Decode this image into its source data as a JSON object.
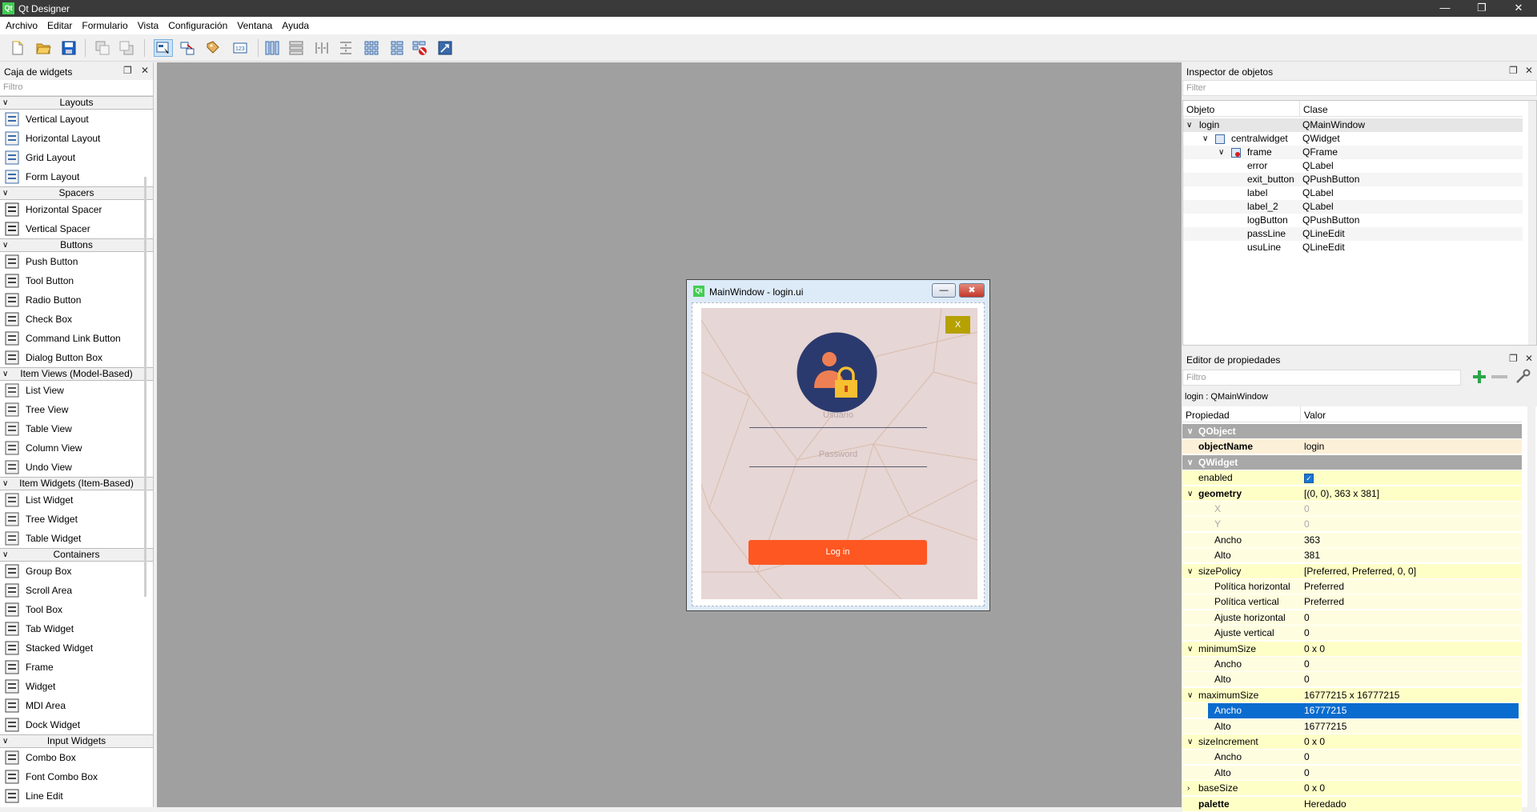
{
  "app": {
    "title": "Qt Designer",
    "logo": "Qt"
  },
  "window_buttons": {
    "minimize": "—",
    "maximize": "❐",
    "close": "✕"
  },
  "menu": [
    "Archivo",
    "Editar",
    "Formulario",
    "Vista",
    "Configuración",
    "Ventana",
    "Ayuda"
  ],
  "toolbar": [
    "new-icon",
    "open-icon",
    "save-icon",
    "send-to-back-icon",
    "bring-to-front-icon",
    "edit-widgets-icon",
    "edit-signals-icon",
    "edit-buddies-icon",
    "edit-tab-order-icon",
    "layout-horizontal-icon",
    "layout-vertical-icon",
    "layout-h-splitter-icon",
    "layout-v-splitter-icon",
    "layout-grid-icon",
    "layout-form-icon",
    "break-layout-icon",
    "adjust-size-icon"
  ],
  "widget_box": {
    "title": "Caja de widgets",
    "filter": "Filtro",
    "categories": [
      {
        "name": "Layouts",
        "items": [
          "Vertical Layout",
          "Horizontal Layout",
          "Grid Layout",
          "Form Layout"
        ]
      },
      {
        "name": "Spacers",
        "items": [
          "Horizontal Spacer",
          "Vertical Spacer"
        ]
      },
      {
        "name": "Buttons",
        "items": [
          "Push Button",
          "Tool Button",
          "Radio Button",
          "Check Box",
          "Command Link Button",
          "Dialog Button Box"
        ]
      },
      {
        "name": "Item Views (Model-Based)",
        "items": [
          "List View",
          "Tree View",
          "Table View",
          "Column View",
          "Undo View"
        ]
      },
      {
        "name": "Item Widgets (Item-Based)",
        "items": [
          "List Widget",
          "Tree Widget",
          "Table Widget"
        ]
      },
      {
        "name": "Containers",
        "items": [
          "Group Box",
          "Scroll Area",
          "Tool Box",
          "Tab Widget",
          "Stacked Widget",
          "Frame",
          "Widget",
          "MDI Area",
          "Dock Widget"
        ]
      },
      {
        "name": "Input Widgets",
        "items": [
          "Combo Box",
          "Font Combo Box",
          "Line Edit"
        ]
      }
    ]
  },
  "form_window": {
    "title": "MainWindow - login.ui",
    "min": "—",
    "close": "✖",
    "exit_button": "X",
    "usuario_placeholder": "Usuario",
    "password_placeholder": "Password",
    "login_button": "Log in",
    "colors": {
      "frame_bg": "#e6d6d5",
      "login": "#fe5722",
      "exit": "#b5a100",
      "avatar": "#2b3a6e"
    }
  },
  "object_inspector": {
    "title": "Inspector de objetos",
    "filter": "Filter",
    "columns": [
      "Objeto",
      "Clase"
    ],
    "rows": [
      {
        "object": "login",
        "class": "QMainWindow",
        "level": 0,
        "expand": "∨"
      },
      {
        "object": "centralwidget",
        "class": "QWidget",
        "level": 1,
        "expand": "∨"
      },
      {
        "object": "frame",
        "class": "QFrame",
        "level": 2,
        "expand": "∨"
      },
      {
        "object": "error",
        "class": "QLabel",
        "level": 3,
        "expand": ""
      },
      {
        "object": "exit_button",
        "class": "QPushButton",
        "level": 3,
        "expand": ""
      },
      {
        "object": "label",
        "class": "QLabel",
        "level": 3,
        "expand": ""
      },
      {
        "object": "label_2",
        "class": "QLabel",
        "level": 3,
        "expand": ""
      },
      {
        "object": "logButton",
        "class": "QPushButton",
        "level": 3,
        "expand": ""
      },
      {
        "object": "passLine",
        "class": "QLineEdit",
        "level": 3,
        "expand": ""
      },
      {
        "object": "usuLine",
        "class": "QLineEdit",
        "level": 3,
        "expand": ""
      }
    ]
  },
  "property_editor": {
    "title": "Editor de propiedades",
    "filter": "Filtro",
    "context": "login : QMainWindow",
    "columns": [
      "Propiedad",
      "Valor"
    ],
    "rows": [
      {
        "name": "QObject",
        "value": "",
        "type": "grp",
        "level": 0,
        "expand": "∨"
      },
      {
        "name": "objectName",
        "value": "login",
        "type": "r",
        "level": 1,
        "bold": true,
        "expand": ""
      },
      {
        "name": "QWidget",
        "value": "",
        "type": "grp",
        "level": 0,
        "expand": "∨"
      },
      {
        "name": "enabled",
        "value": "✓",
        "type": "y",
        "level": 1,
        "check": true,
        "expand": ""
      },
      {
        "name": "geometry",
        "value": "[(0, 0), 363 x 381]",
        "type": "y",
        "level": 1,
        "bold": true,
        "expand": "∨"
      },
      {
        "name": "X",
        "value": "0",
        "type": "yp",
        "level": 2,
        "dim": true,
        "expand": ""
      },
      {
        "name": "Y",
        "value": "0",
        "type": "yp",
        "level": 2,
        "dim": true,
        "expand": ""
      },
      {
        "name": "Ancho",
        "value": "363",
        "type": "yp",
        "level": 2,
        "expand": ""
      },
      {
        "name": "Alto",
        "value": "381",
        "type": "yp",
        "level": 2,
        "expand": ""
      },
      {
        "name": "sizePolicy",
        "value": "[Preferred, Preferred, 0, 0]",
        "type": "y",
        "level": 1,
        "expand": "∨"
      },
      {
        "name": "Política horizontal",
        "value": "Preferred",
        "type": "yp",
        "level": 2,
        "expand": ""
      },
      {
        "name": "Política vertical",
        "value": "Preferred",
        "type": "yp",
        "level": 2,
        "expand": ""
      },
      {
        "name": "Ajuste horizontal",
        "value": "0",
        "type": "yp",
        "level": 2,
        "expand": ""
      },
      {
        "name": "Ajuste vertical",
        "value": "0",
        "type": "yp",
        "level": 2,
        "expand": ""
      },
      {
        "name": "minimumSize",
        "value": "0 x 0",
        "type": "y",
        "level": 1,
        "expand": "∨"
      },
      {
        "name": "Ancho",
        "value": "0",
        "type": "yp",
        "level": 2,
        "expand": ""
      },
      {
        "name": "Alto",
        "value": "0",
        "type": "yp",
        "level": 2,
        "expand": ""
      },
      {
        "name": "maximumSize",
        "value": "16777215 x 16777215",
        "type": "y",
        "level": 1,
        "expand": "∨"
      },
      {
        "name": "Ancho",
        "value": "16777215",
        "type": "yp",
        "level": 2,
        "selected": true,
        "expand": ""
      },
      {
        "name": "Alto",
        "value": "16777215",
        "type": "yp",
        "level": 2,
        "expand": ""
      },
      {
        "name": "sizeIncrement",
        "value": "0 x 0",
        "type": "y",
        "level": 1,
        "expand": "∨"
      },
      {
        "name": "Ancho",
        "value": "0",
        "type": "yp",
        "level": 2,
        "expand": ""
      },
      {
        "name": "Alto",
        "value": "0",
        "type": "yp",
        "level": 2,
        "expand": ""
      },
      {
        "name": "baseSize",
        "value": "0 x 0",
        "type": "y",
        "level": 1,
        "expand": "›"
      },
      {
        "name": "palette",
        "value": "Heredado",
        "type": "y",
        "level": 1,
        "bold": true,
        "expand": ""
      }
    ]
  },
  "dock_icons": {
    "float": "❐",
    "close": "✕"
  }
}
